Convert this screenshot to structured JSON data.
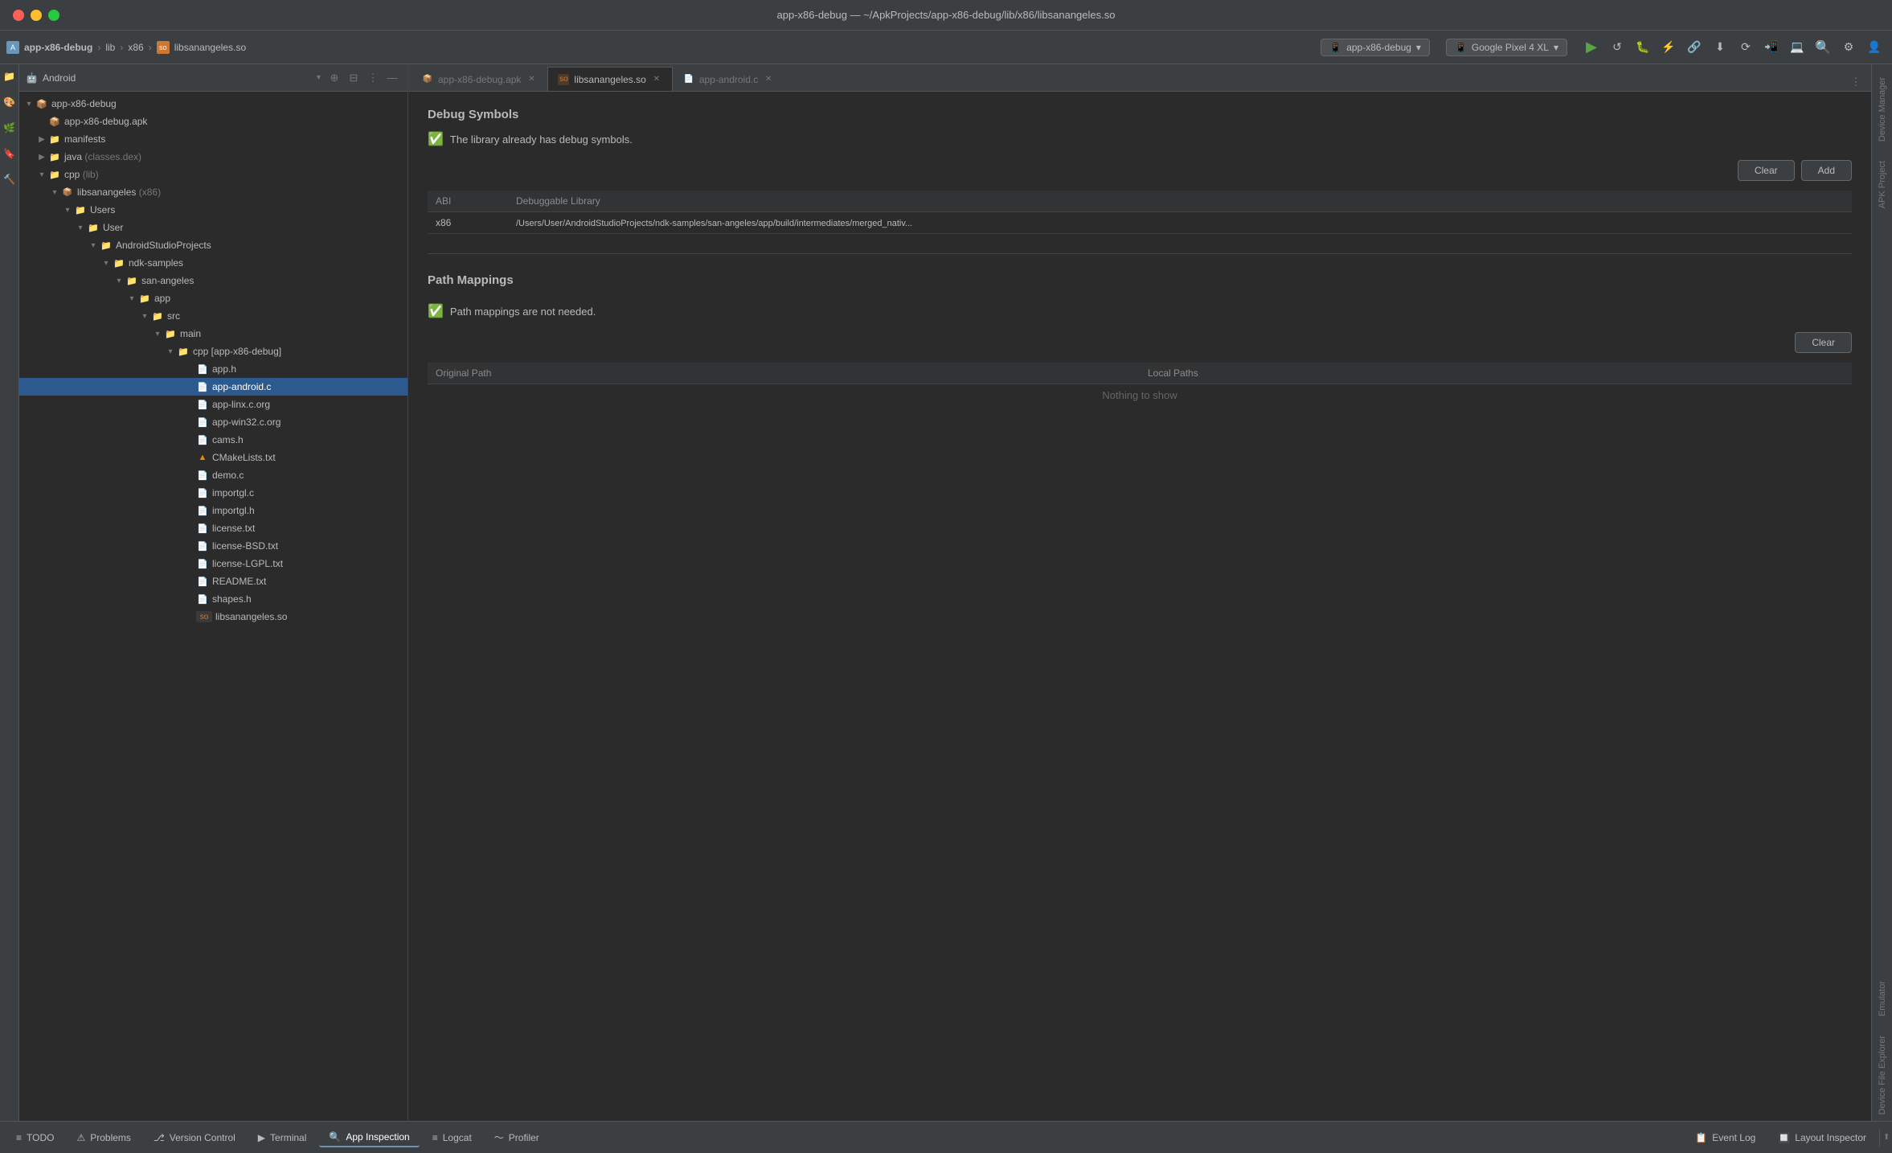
{
  "titleBar": {
    "title": "app-x86-debug — ~/ApkProjects/app-x86-debug/lib/x86/libsanangeles.so"
  },
  "toolbar": {
    "breadcrumbs": [
      "app-x86-debug",
      "lib",
      "x86",
      "libsanangeles.so"
    ],
    "device": "app-x86-debug",
    "emulator": "Google Pixel 4 XL"
  },
  "projectPanel": {
    "title": "Android",
    "items": [
      {
        "id": "app-x86-debug",
        "label": "app-x86-debug",
        "type": "module",
        "depth": 0,
        "expanded": true
      },
      {
        "id": "apk",
        "label": "app-x86-debug.apk",
        "type": "apk",
        "depth": 1
      },
      {
        "id": "manifests",
        "label": "manifests",
        "type": "folder",
        "depth": 1
      },
      {
        "id": "java",
        "label": "java",
        "type": "folder",
        "depth": 1,
        "extra": "(classes.dex)"
      },
      {
        "id": "cpp-lib",
        "label": "cpp",
        "type": "folder-cpp",
        "depth": 1,
        "extra": "(lib)"
      },
      {
        "id": "libsanangeles",
        "label": "libsanangeles",
        "type": "module-cpp",
        "depth": 2,
        "extra": "(x86)",
        "selected": false
      },
      {
        "id": "Users",
        "label": "Users",
        "type": "folder",
        "depth": 3
      },
      {
        "id": "User",
        "label": "User",
        "type": "folder",
        "depth": 4
      },
      {
        "id": "AndroidStudioProjects",
        "label": "AndroidStudioProjects",
        "type": "folder",
        "depth": 5
      },
      {
        "id": "ndk-samples",
        "label": "ndk-samples",
        "type": "folder",
        "depth": 6
      },
      {
        "id": "san-angeles",
        "label": "san-angeles",
        "type": "folder",
        "depth": 7
      },
      {
        "id": "app",
        "label": "app",
        "type": "folder",
        "depth": 8
      },
      {
        "id": "src",
        "label": "src",
        "type": "folder",
        "depth": 9
      },
      {
        "id": "main",
        "label": "main",
        "type": "folder",
        "depth": 10
      },
      {
        "id": "cpp-build",
        "label": "cpp [app-x86-debug]",
        "type": "folder-cpp",
        "depth": 11
      },
      {
        "id": "app-h",
        "label": "app.h",
        "type": "file-c",
        "depth": 12
      },
      {
        "id": "app-android-c",
        "label": "app-android.c",
        "type": "file-c",
        "depth": 12,
        "selected": true
      },
      {
        "id": "app-linx",
        "label": "app-linx.c.org",
        "type": "file-c",
        "depth": 12
      },
      {
        "id": "app-win32",
        "label": "app-win32.c.org",
        "type": "file-c",
        "depth": 12
      },
      {
        "id": "cams-h",
        "label": "cams.h",
        "type": "file-c",
        "depth": 12
      },
      {
        "id": "cmake",
        "label": "CMakeLists.txt",
        "type": "file-cmake",
        "depth": 12
      },
      {
        "id": "demo-c",
        "label": "demo.c",
        "type": "file-c",
        "depth": 12
      },
      {
        "id": "importgl-c",
        "label": "importgl.c",
        "type": "file-c",
        "depth": 12
      },
      {
        "id": "importgl-h",
        "label": "importgl.h",
        "type": "file-c",
        "depth": 12
      },
      {
        "id": "license-txt",
        "label": "license.txt",
        "type": "file-txt",
        "depth": 12
      },
      {
        "id": "license-bsd",
        "label": "license-BSD.txt",
        "type": "file-txt",
        "depth": 12
      },
      {
        "id": "license-lgpl",
        "label": "license-LGPL.txt",
        "type": "file-txt",
        "depth": 12
      },
      {
        "id": "readme",
        "label": "README.txt",
        "type": "file-txt",
        "depth": 12
      },
      {
        "id": "shapes-h",
        "label": "shapes.h",
        "type": "file-c",
        "depth": 12
      },
      {
        "id": "libsanangeles-so",
        "label": "libsanangeles.so",
        "type": "file-so",
        "depth": 12
      }
    ]
  },
  "tabs": [
    {
      "id": "apk-tab",
      "label": "app-x86-debug.apk",
      "icon": "apk",
      "active": false
    },
    {
      "id": "so-tab",
      "label": "libsanangeles.so",
      "icon": "so",
      "active": true
    },
    {
      "id": "c-tab",
      "label": "app-android.c",
      "icon": "c",
      "active": false
    }
  ],
  "debugSymbols": {
    "sectionTitle": "Debug Symbols",
    "statusText": "The library already has debug symbols.",
    "clearLabel": "Clear",
    "addLabel": "Add",
    "tableHeaders": [
      "ABI",
      "Debuggable Library"
    ],
    "tableRows": [
      {
        "abi": "x86",
        "path": "/Users/User/AndroidStudioProjects/ndk-samples/san-angeles/app/build/intermediates/merged_nativ..."
      }
    ]
  },
  "pathMappings": {
    "sectionTitle": "Path Mappings",
    "statusText": "Path mappings are not needed.",
    "clearLabel": "Clear",
    "tableHeaders": [
      "Original Path",
      "Local Paths"
    ],
    "emptyText": "Nothing to show"
  },
  "rightSidebar": {
    "tabs": [
      "Device Manager",
      "APK Project",
      "Emulator",
      "Device File Explorer"
    ]
  },
  "bottomBar": {
    "tabs": [
      {
        "id": "todo",
        "label": "TODO",
        "icon": "≡"
      },
      {
        "id": "problems",
        "label": "Problems",
        "icon": "⚠"
      },
      {
        "id": "version-control",
        "label": "Version Control",
        "icon": "⎇"
      },
      {
        "id": "terminal",
        "label": "Terminal",
        "icon": "▶"
      },
      {
        "id": "app-inspection",
        "label": "App Inspection",
        "icon": "🔍"
      },
      {
        "id": "logcat",
        "label": "Logcat",
        "icon": "≡"
      },
      {
        "id": "profiler",
        "label": "Profiler",
        "icon": "〜"
      }
    ],
    "rightTabs": [
      {
        "id": "event-log",
        "label": "Event Log",
        "icon": "📋"
      },
      {
        "id": "layout-inspector",
        "label": "Layout Inspector",
        "icon": "🔲"
      }
    ]
  }
}
